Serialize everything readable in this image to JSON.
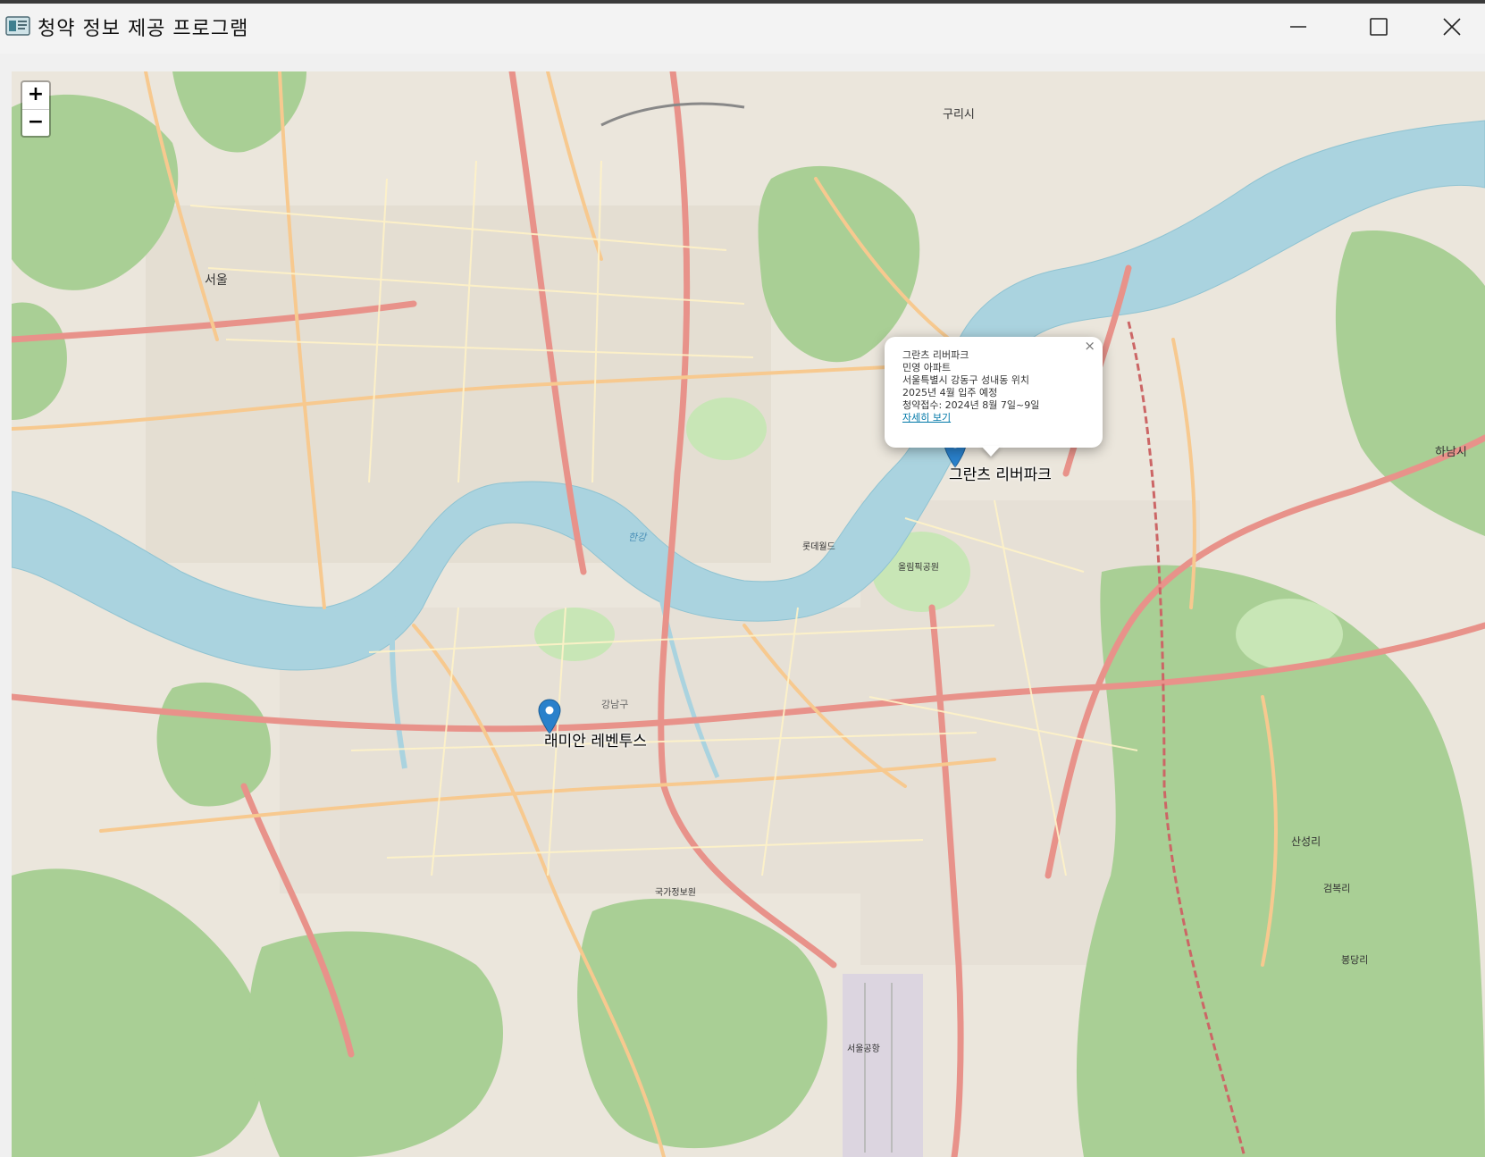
{
  "window": {
    "title": "청약 정보 제공 프로그램"
  },
  "map": {
    "zoom_in_label": "+",
    "zoom_out_label": "−",
    "place_labels": [
      "서울",
      "구리시",
      "하남시",
      "산성리",
      "검복리",
      "봉당리",
      "한강",
      "롯데월드",
      "강남구",
      "서울공항",
      "올림픽공원",
      "국가정보원"
    ],
    "markers": [
      {
        "name": "그란츠 리버파크"
      },
      {
        "name": "래미안 레벤투스"
      }
    ],
    "popup": {
      "close_label": "×",
      "title": "그란츠 리버파크",
      "type": "민영 아파트",
      "location": "서울특별시 강동구 성내동 위치",
      "move_in": "2025년 4월 입주 예정",
      "subscription": "청약접수: 2024년 8월 7일~9일",
      "link_label": "자세히 보기"
    },
    "colors": {
      "land": "#efebe3",
      "park": "#aed1a0",
      "forest": "#9ccb8a",
      "water": "#aad3df",
      "major_road": "#e8928a",
      "secondary_road": "#fcd6a4",
      "marker": "#2a81cb"
    }
  }
}
